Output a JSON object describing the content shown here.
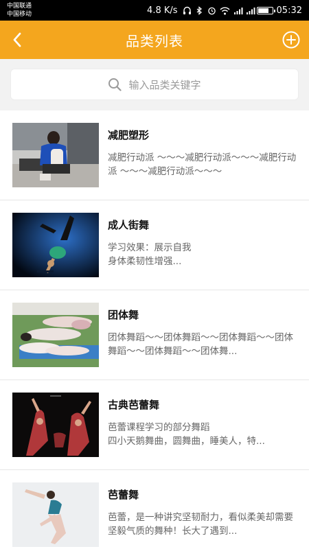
{
  "status_bar": {
    "carrier_1": "中国联通",
    "carrier_2": "中国移动",
    "speed": "4.8 K/s",
    "time": "05:32",
    "battery_level": 0.8
  },
  "nav": {
    "title": "品类列表",
    "back_icon": "chevron-left-icon",
    "add_icon": "circle-plus-icon"
  },
  "search": {
    "placeholder": "输入品类关键字",
    "icon": "search-icon"
  },
  "categories": [
    {
      "title": "减肥塑形",
      "desc": "减肥行动派 ～～～减肥行动派～～～减肥行动派 ～～～减肥行动派～～～"
    },
    {
      "title": "成人街舞",
      "desc": "学习效果：展示自我\n身体柔韧性增强..."
    },
    {
      "title": "团体舞",
      "desc": "团体舞蹈～～团体舞蹈～～团体舞蹈～～团体舞蹈～～团体舞蹈～～团体舞..."
    },
    {
      "title": "古典芭蕾舞",
      "desc": "芭蕾课程学习的部分舞蹈\n四小天鹅舞曲，圆舞曲，睡美人，特..."
    },
    {
      "title": "芭蕾舞",
      "desc": "芭蕾，是一种讲究坚韧耐力，看似柔美却需要坚毅气质的舞种！长大了遇到..."
    }
  ],
  "colors": {
    "accent": "#f4a61e",
    "background": "#f2f2f2"
  }
}
